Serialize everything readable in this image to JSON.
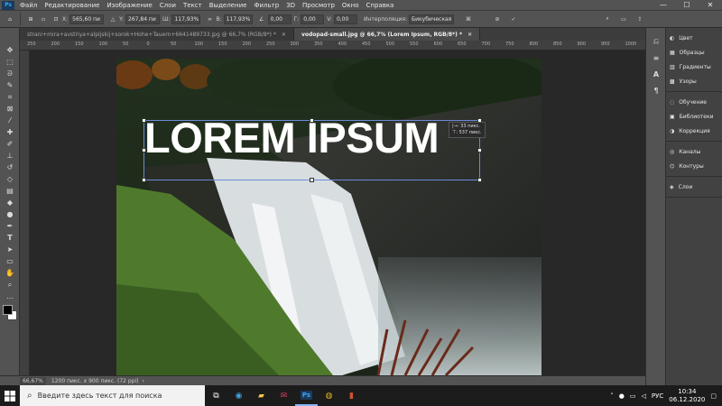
{
  "app": {
    "logo": "Ps"
  },
  "menu": [
    "Файл",
    "Редактирование",
    "Изображение",
    "Слои",
    "Текст",
    "Выделение",
    "Фильтр",
    "3D",
    "Просмотр",
    "Окно",
    "Справка"
  ],
  "options": {
    "x_label": "X:",
    "x_value": "565,60 пи",
    "y_label": "Y:",
    "y_value": "267,84 пи",
    "w_label": "Ш:",
    "w_value": "117,93%",
    "h_label": "В:",
    "h_value": "117,93%",
    "angle_value": "0,00",
    "hskew_label": "Г:",
    "hskew_value": "0,00",
    "vskew_label": "V:",
    "vskew_value": "0,00",
    "interp_label": "Интерполяция:",
    "interp_value": "Бикубическая"
  },
  "tabs": [
    {
      "label": "strani+mira+avstriya+alpijskij+sorok+Hohe+Tauern+6641489733.jpg @ 66,7% (RGB/8*) *"
    },
    {
      "label": "vodopad-small.jpg @ 66,7% (Lorem Ipsum, RGB/8*) *"
    }
  ],
  "ruler_ticks": [
    "250",
    "200",
    "150",
    "100",
    "50",
    "0",
    "50",
    "100",
    "150",
    "200",
    "250",
    "300",
    "350",
    "400",
    "450",
    "500",
    "550",
    "600",
    "650",
    "700",
    "750",
    "800",
    "850",
    "900",
    "950",
    "1000"
  ],
  "canvas": {
    "overlay_text": "LOREM IPSUM",
    "tip_line1": "|→: 33 пикс.",
    "tip_line2": "⊤: 537 пикс."
  },
  "status": {
    "zoom": "66,67%",
    "doc_info": "1200 пикс. x 900 пикс. (72 ppi)"
  },
  "panels": {
    "group1": [
      "Цвет",
      "Образцы",
      "Градиенты",
      "Узоры"
    ],
    "group2": [
      "Обучение",
      "Библиотеки",
      "Коррекция"
    ],
    "group3": [
      "Каналы",
      "Контуры"
    ],
    "group4": [
      "Слои"
    ]
  },
  "taskbar": {
    "search_placeholder": "Введите здесь текст для поиска",
    "lang": "РУС",
    "time": "10:34",
    "date": "06.12.2020"
  }
}
